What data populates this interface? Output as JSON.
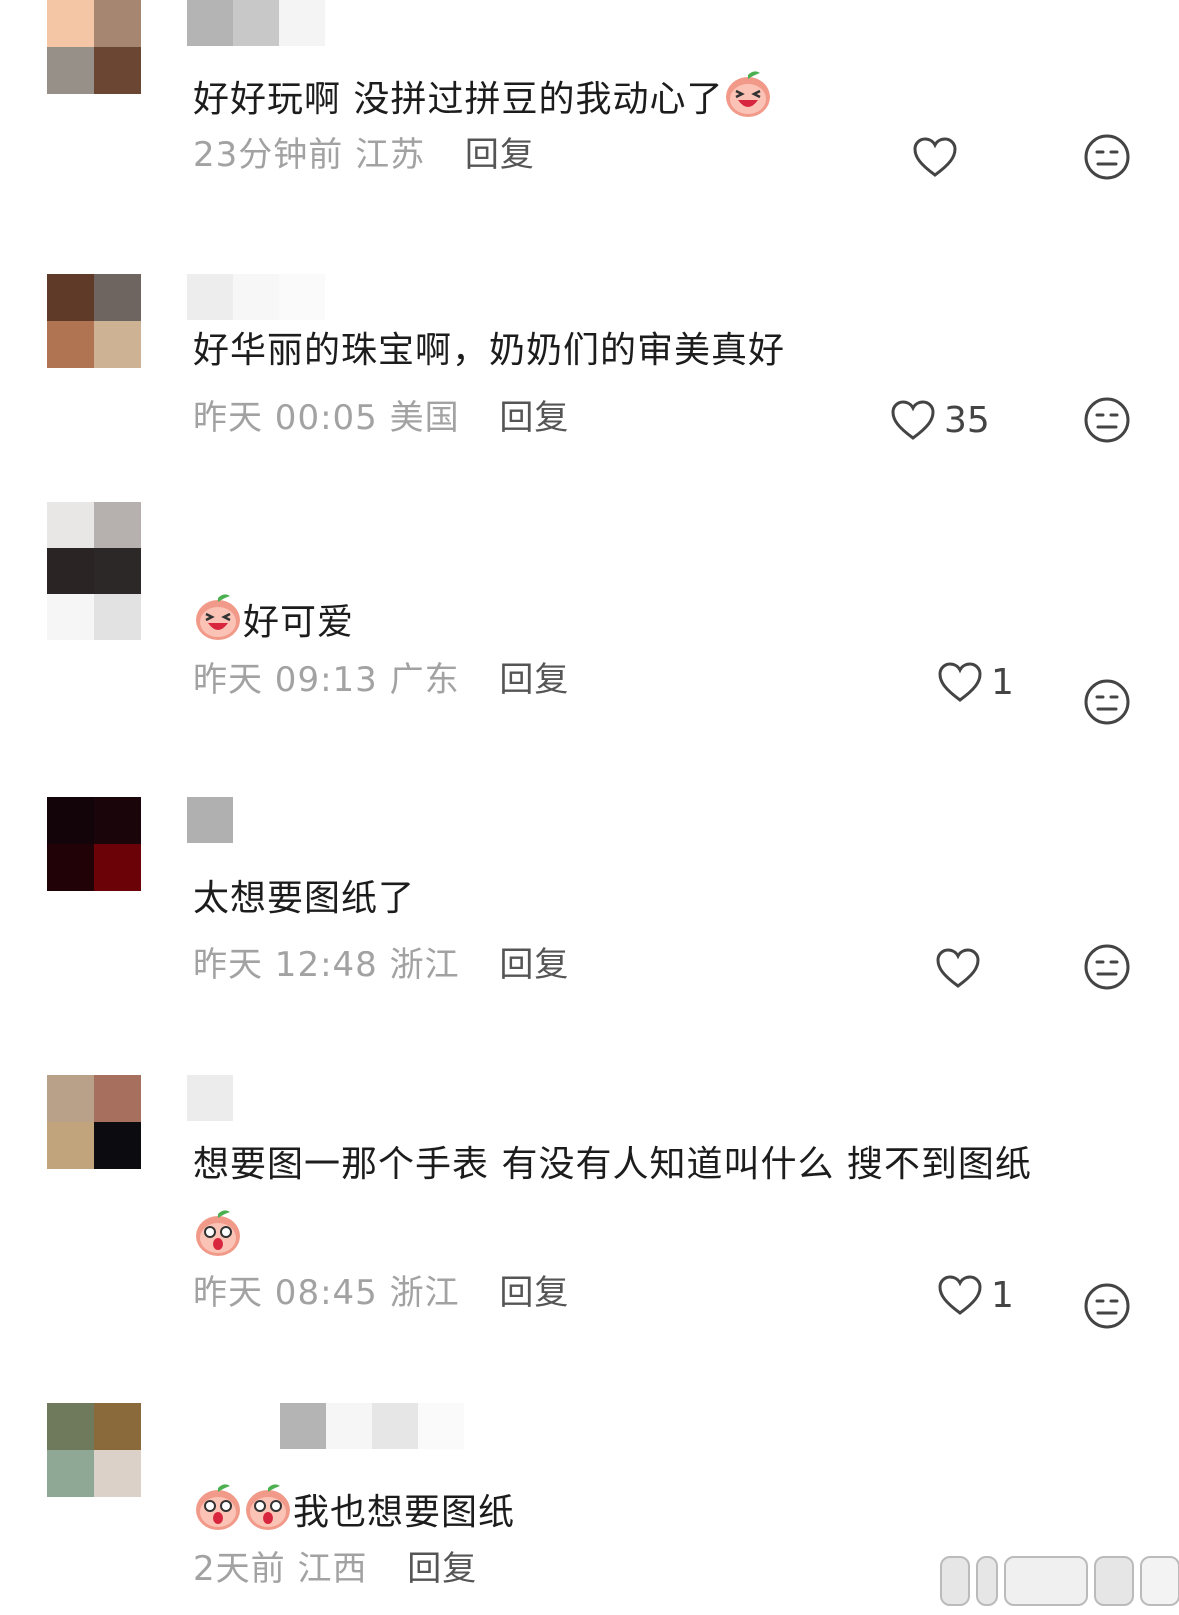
{
  "comments": [
    {
      "text": "好好玩啊 没拼过拼豆的我动心了",
      "time": "23分钟前",
      "location": "江苏",
      "reply": "回复",
      "likes": "",
      "emoji_end": 1,
      "emoji_start": 0,
      "avatar_colors": [
        "#f5c6a5",
        "#a68571",
        "#979089",
        "#6b4633"
      ]
    },
    {
      "text": "好华丽的珠宝啊，奶奶们的审美真好",
      "time": "昨天 00:05",
      "location": "美国",
      "reply": "回复",
      "likes": "35",
      "emoji_end": 0,
      "emoji_start": 0,
      "avatar_colors": [
        "#5f3a28",
        "#6f6560",
        "#b07452",
        "#cdb293"
      ]
    },
    {
      "text": "好可爱",
      "time": "昨天 09:13",
      "location": "广东",
      "reply": "回复",
      "likes": "1",
      "emoji_end": 0,
      "emoji_start": 1,
      "avatar_colors": [
        "#e9e7e6",
        "#b6b0ae",
        "#2a2424",
        "#2d2828"
      ]
    },
    {
      "text": "太想要图纸了",
      "time": "昨天 12:48",
      "location": "浙江",
      "reply": "回复",
      "likes": "",
      "emoji_end": 0,
      "emoji_start": 0,
      "avatar_colors": [
        "#120409",
        "#1a050a",
        "#210207",
        "#6a0207"
      ]
    },
    {
      "text": "想要图一那个手表 有没有人知道叫什么 搜不到图纸",
      "time": "昨天 08:45",
      "location": "浙江",
      "reply": "回复",
      "likes": "1",
      "emoji_end": 0,
      "emoji_start": 0,
      "avatar_colors": [
        "#b8a089",
        "#a76f5d",
        "#c2a47c",
        "#0b0b10"
      ]
    },
    {
      "text": "我也想要图纸",
      "time": "2天前",
      "location": "江西",
      "reply": "回复",
      "likes": "",
      "emoji_end": 0,
      "emoji_start": 2,
      "avatar_colors": [
        "#6f7a5c",
        "#8a6a3a",
        "#8fa895",
        "#dcd1c8"
      ]
    }
  ],
  "icons": {
    "like": "heart-outline-icon",
    "dislike": "meh-face-icon",
    "sticker": "peach-laughing-sticker"
  }
}
